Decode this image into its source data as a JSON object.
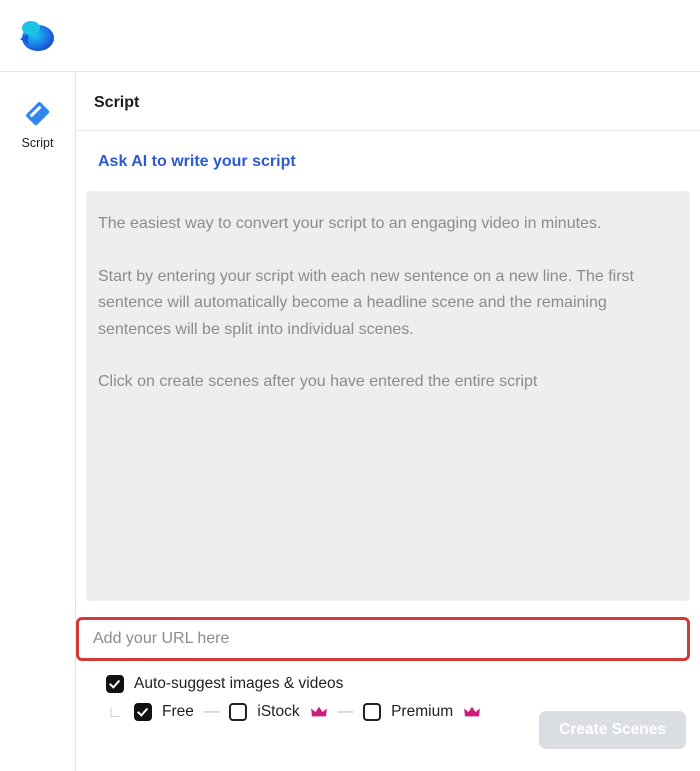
{
  "sidebar": {
    "label": "Script"
  },
  "header": {
    "title": "Script"
  },
  "ask_ai": {
    "label": "Ask AI to write your script"
  },
  "script_placeholder": "The easiest way to convert your script to an engaging video in minutes.\n\nStart by entering your script with each new sentence on a new line. The first sentence will automatically become a headline scene and the remaining sentences will be split into individual scenes.\n\nClick on create scenes after you have entered the entire script",
  "url_input": {
    "placeholder": "Add your URL here",
    "value": ""
  },
  "options": {
    "auto_suggest_label": "Auto-suggest images & videos",
    "auto_suggest_checked": true,
    "free": {
      "label": "Free",
      "checked": true
    },
    "istock": {
      "label": "iStock",
      "checked": false
    },
    "premium": {
      "label": "Premium",
      "checked": false
    }
  },
  "create_button": {
    "label": "Create Scenes"
  },
  "colors": {
    "accent_blue": "#2e5ad0",
    "highlight_red": "#d23a3a",
    "crown_pink": "#cf1c7b"
  }
}
